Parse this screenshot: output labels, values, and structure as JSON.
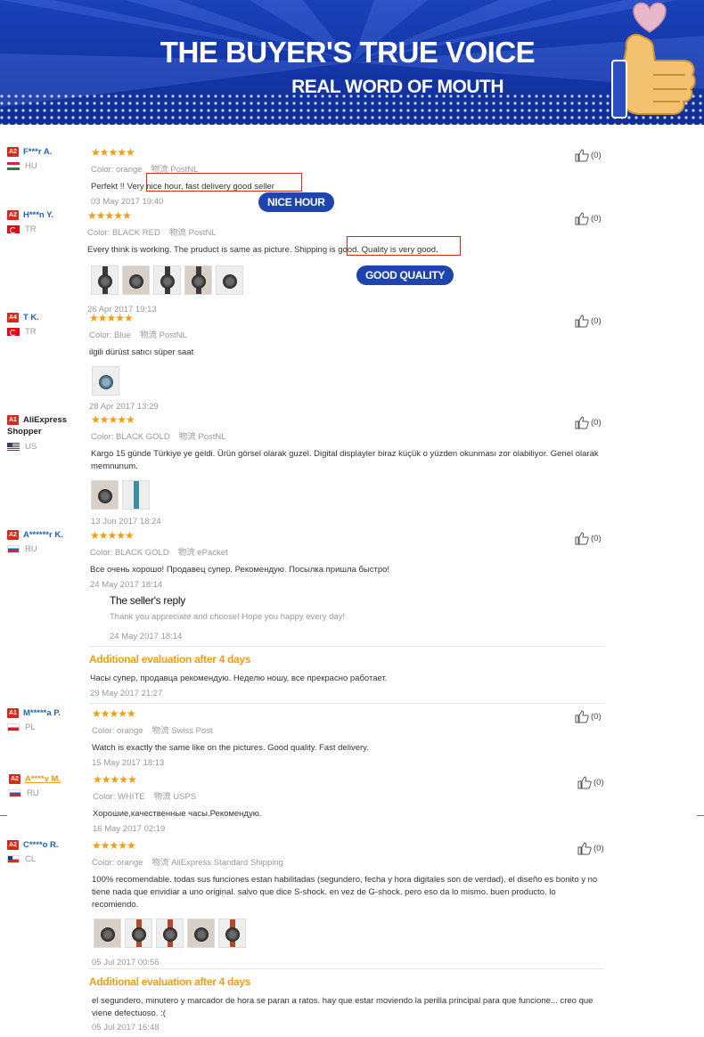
{
  "banner": {
    "title": "THE BUYER'S TRUE VOICE",
    "subtitle": "REAL WORD OF MOUTH"
  },
  "labels": {
    "color": "Color:",
    "logistics": "物流",
    "seller_reply": "The seller's reply",
    "additional": "Additional evaluation after 4 days"
  },
  "reviews": [
    {
      "level": "A2",
      "name": "F***r A.",
      "country": "HU",
      "flag": "hu",
      "stars": "★★★★★",
      "color": "orange",
      "shipping": "PostNL",
      "text": "Perfekt !! Very nice hour, fast delivery good seller",
      "date": "03 May 2017 19:40",
      "likes": "(0)",
      "callout": "NICE HOUR"
    },
    {
      "level": "A2",
      "name": "H***n Y.",
      "country": "TR",
      "flag": "tr",
      "stars": "★★★★★",
      "color": "BLACK RED",
      "shipping": "PostNL",
      "text": "Every think is working. The pruduct is same as picture. Shipping is good. Quality is very good.",
      "date": "26 Apr 2017 19:13",
      "likes": "(0)",
      "photos": 5,
      "callout": "GOOD QUALITY"
    },
    {
      "level": "A4",
      "name": "T K.",
      "country": "TR",
      "flag": "tr",
      "stars": "★★★★★",
      "color": "Blue",
      "shipping": "PostNL",
      "text": "ilgili dürüst satıcı süper saat",
      "date": "28 Apr 2017 13:29",
      "likes": "(0)",
      "photos": 1
    },
    {
      "level": "A1",
      "name": "AliExpress Shopper",
      "country": "US",
      "flag": "us",
      "stars": "★★★★★",
      "color": "BLACK GOLD",
      "shipping": "PostNL",
      "text": "Kargo 15 günde Türkiye ye geldi. Ürün görsel olarak guzel. Digital displayler biraz küçük o yüzden okunması zor olabiliyor. Genel olarak memnunum.",
      "date": "13 Jun 2017 18:24",
      "likes": "(0)",
      "photos": 2
    },
    {
      "level": "A2",
      "name": "A******r K.",
      "country": "RU",
      "flag": "ru",
      "stars": "★★★★★",
      "color": "BLACK GOLD",
      "shipping": "ePacket",
      "text": "Все очень хорошо! Продавец супер. Рекомендую. Посылка пришла быстро!",
      "date": "24 May 2017 18:14",
      "likes": "(0)",
      "reply": {
        "text": "Thank you appreciate and choose! Hope you happy every day!",
        "date": "24 May 2017 18:14"
      },
      "additional": {
        "text": "Часы супер, продавца рекомендую. Неделю ношу, все прекрасно работает.",
        "date": "29 May 2017 21:27"
      }
    },
    {
      "level": "A1",
      "name": "M*****a P.",
      "country": "PL",
      "flag": "pl",
      "stars": "★★★★★",
      "color": "orange",
      "shipping": "Swiss Post",
      "text": "Watch is exactly the same like on the pictures. Good quality. Fast delivery.",
      "date": "15 May 2017 18:13",
      "likes": "(0)"
    },
    {
      "level": "A2",
      "name": "A****y M.",
      "country": "RU",
      "flag": "ru",
      "stars": "★★★★★",
      "color": "WHITE",
      "shipping": "USPS",
      "text": "Хорошие,качественные часы.Рекомендую.",
      "date": "16 May 2017 02:19",
      "likes": "(0)"
    },
    {
      "level": "A2",
      "name": "C****o R.",
      "country": "CL",
      "flag": "cl",
      "stars": "★★★★★",
      "color": "orange",
      "shipping": "AliExpress Standard Shipping",
      "text": "100% recomendable. todas sus funciones estan habilitadas (segundero, fecha y hora digitales son de verdad). el diseño es bonito y no tiene nada que envidiar a uno original. salvo que dice S-shock. en vez de G-shock. pero eso da lo mismo. buen producto. lo recomiendo.",
      "date": "05 Jul 2017 00:56",
      "likes": "(0)",
      "photos": 5,
      "additional": {
        "text": "el segundero, minutero y marcador de hora se paran a ratos. hay que estar moviendo la perilla principal para que funcione... creo que viene defectuoso. :(",
        "date": "05 Jul 2017 16:48"
      }
    }
  ]
}
